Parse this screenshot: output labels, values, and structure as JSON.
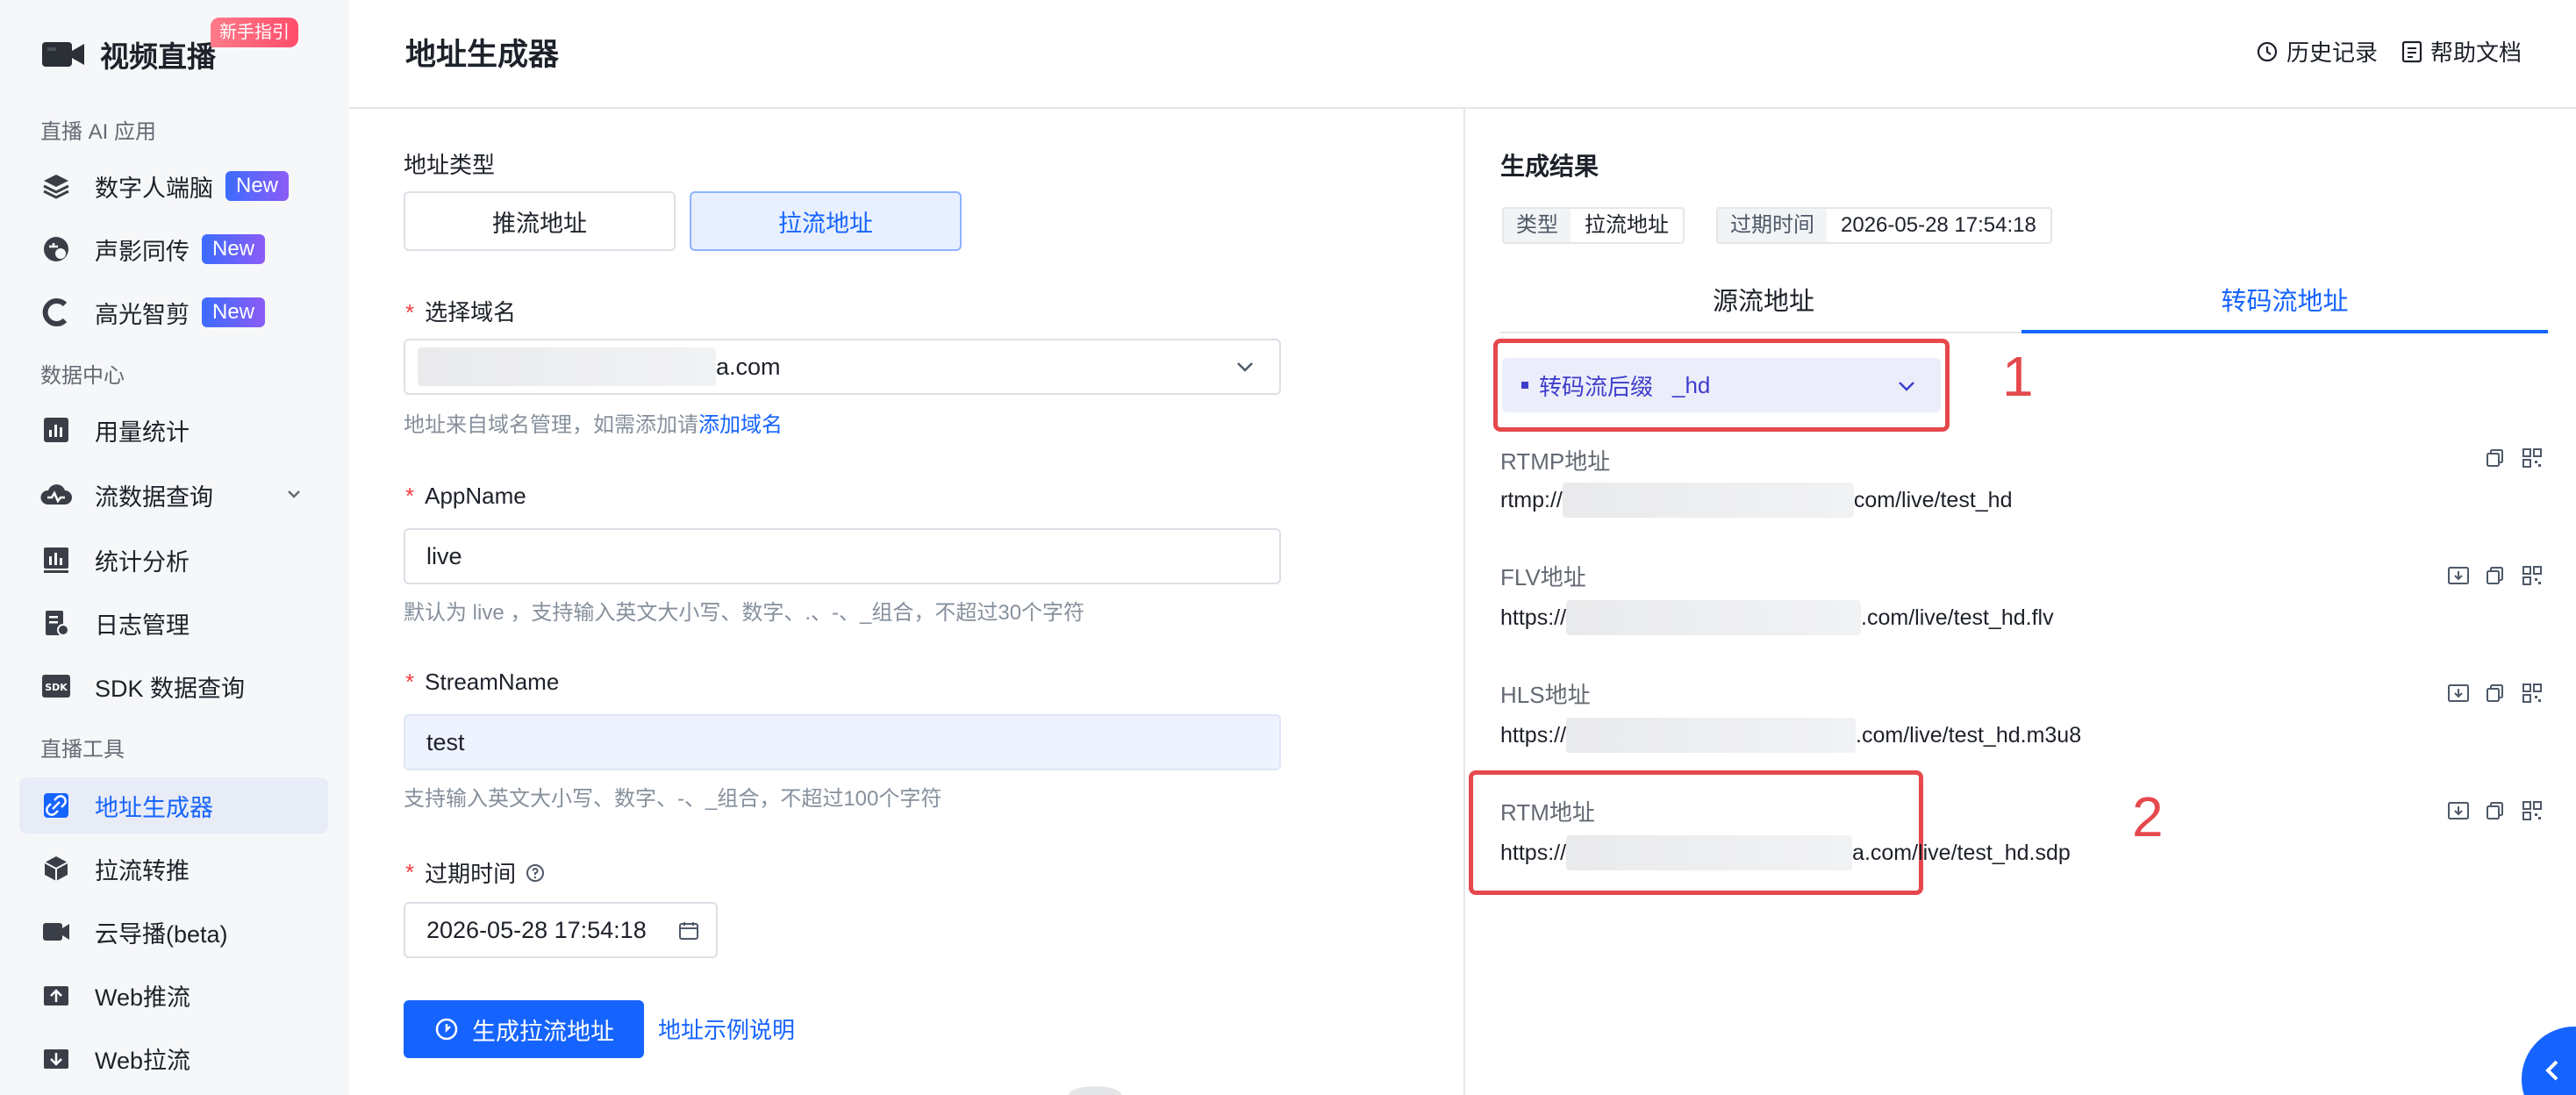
{
  "sidebar": {
    "brand_title": "视频直播",
    "guide_badge": "新手指引",
    "sections": {
      "ai": "直播 AI 应用",
      "data": "数据中心",
      "tools": "直播工具"
    },
    "items": [
      {
        "label": "数字人端脑",
        "badge": "New",
        "icon": "layers-icon"
      },
      {
        "label": "声影同传",
        "badge": "New",
        "icon": "translate-icon"
      },
      {
        "label": "高光智剪",
        "badge": "New",
        "icon": "highlight-clip-icon"
      },
      {
        "label": "用量统计",
        "icon": "bar-chart-icon"
      },
      {
        "label": "流数据查询",
        "icon": "cloud-pulse-icon"
      },
      {
        "label": "统计分析",
        "icon": "analytics-icon"
      },
      {
        "label": "日志管理",
        "icon": "log-file-icon"
      },
      {
        "label": "SDK 数据查询",
        "icon": "sdk-icon"
      },
      {
        "label": "地址生成器",
        "icon": "link-icon",
        "active": true
      },
      {
        "label": "拉流转推",
        "icon": "cube-icon"
      },
      {
        "label": "云导播(beta)",
        "icon": "camera-icon"
      },
      {
        "label": "Web推流",
        "icon": "upload-icon"
      },
      {
        "label": "Web拉流",
        "icon": "download-icon"
      }
    ]
  },
  "header": {
    "title": "地址生成器",
    "history": "历史记录",
    "docs": "帮助文档"
  },
  "form": {
    "address_type_label": "地址类型",
    "push_btn": "推流地址",
    "pull_btn": "拉流地址",
    "domain_label": "选择域名",
    "domain_value_suffix": "a.com",
    "domain_hint": "地址来自域名管理，如需添加请",
    "domain_hint_link": "添加域名",
    "app_label": "AppName",
    "app_value": "live",
    "app_hint": "默认为 live ，支持输入英文大小写、数字、.、-、_组合，不超过30个字符",
    "stream_label": "StreamName",
    "stream_value": "test",
    "stream_hint": "支持输入英文大小写、数字、-、_组合，不超过100个字符",
    "expire_label": "过期时间",
    "expire_value": "2026-05-28 17:54:18",
    "generate_btn": "生成拉流地址",
    "example_link": "地址示例说明"
  },
  "result": {
    "title": "生成结果",
    "type_key": "类型",
    "type_val": "拉流地址",
    "expire_key": "过期时间",
    "expire_val": "2026-05-28 17:54:18",
    "tab_source": "源流地址",
    "tab_transcode": "转码流地址",
    "suffix_label": "转码流后缀",
    "suffix_value": "_hd",
    "annotation_1": "1",
    "annotation_2": "2",
    "addresses": [
      {
        "label": "RTMP地址",
        "prefix": "rtmp://",
        "suffix": "com/live/test_hd"
      },
      {
        "label": "FLV地址",
        "prefix": "https://",
        "suffix": ".com/live/test_hd.flv"
      },
      {
        "label": "HLS地址",
        "prefix": "https://",
        "suffix": ".com/live/test_hd.m3u8"
      },
      {
        "label": "RTM地址",
        "prefix": "https://",
        "suffix": "a.com/live/test_hd.sdp"
      }
    ]
  }
}
